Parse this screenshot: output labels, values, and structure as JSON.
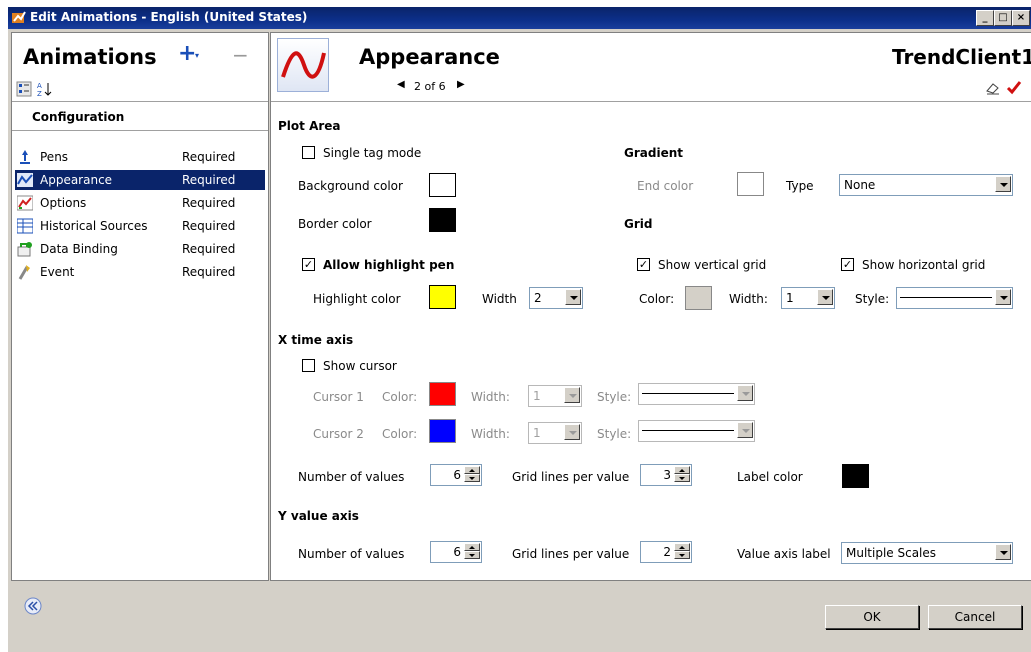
{
  "window": {
    "title": "Edit Animations - English (United States)"
  },
  "left": {
    "title": "Animations",
    "add_label": "+",
    "remove_label": "−",
    "section_header": "Configuration",
    "items": [
      {
        "name": "Pens",
        "status": "Required",
        "icon": "pen-icon"
      },
      {
        "name": "Appearance",
        "status": "Required",
        "icon": "trend-icon",
        "selected": true
      },
      {
        "name": "Options",
        "status": "Required",
        "icon": "options-icon"
      },
      {
        "name": "Historical Sources",
        "status": "Required",
        "icon": "historical-icon"
      },
      {
        "name": "Data Binding",
        "status": "Required",
        "icon": "data-binding-icon"
      },
      {
        "name": "Event",
        "status": "Required",
        "icon": "event-icon"
      }
    ]
  },
  "header": {
    "title": "Appearance",
    "pager": "2 of 6",
    "object_name": "TrendClient1"
  },
  "plot_area": {
    "section": "Plot Area",
    "single_tag_mode": "Single tag mode",
    "background_color": "Background color",
    "border_color": "Border color",
    "allow_highlight_pen": "Allow highlight pen",
    "highlight_color": "Highlight color",
    "width_label": "Width",
    "width_value": "2",
    "colors": {
      "background": "#ffffff",
      "border": "#000000",
      "highlight": "#ffff00"
    }
  },
  "gradient": {
    "section": "Gradient",
    "end_color": "End color",
    "type_label": "Type",
    "type_value": "None",
    "end_color_value": "#ffffff"
  },
  "grid": {
    "section": "Grid",
    "show_vertical": "Show vertical grid",
    "show_horizontal": "Show horizontal grid",
    "color_label": "Color:",
    "width_label": "Width:",
    "width_value": "1",
    "style_label": "Style:",
    "color_value": "#d4d0c8"
  },
  "x_axis": {
    "section": "X time axis",
    "show_cursor": "Show cursor",
    "cursor1": "Cursor 1",
    "cursor2": "Cursor 2",
    "color_label": "Color:",
    "width_label": "Width:",
    "style_label": "Style:",
    "cursor1_width": "1",
    "cursor2_width": "1",
    "cursor1_color": "#ff0000",
    "cursor2_color": "#0000ff",
    "number_of_values": "Number of values",
    "number_value": "6",
    "grid_lines": "Grid lines per value",
    "grid_lines_value": "3",
    "label_color": "Label color",
    "label_color_value": "#000000"
  },
  "y_axis": {
    "section": "Y value axis",
    "number_of_values": "Number of values",
    "number_value": "6",
    "grid_lines": "Grid lines per value",
    "grid_lines_value": "2",
    "value_axis_label": "Value axis label",
    "value_axis_value": "Multiple Scales"
  },
  "footer": {
    "ok": "OK",
    "cancel": "Cancel"
  }
}
